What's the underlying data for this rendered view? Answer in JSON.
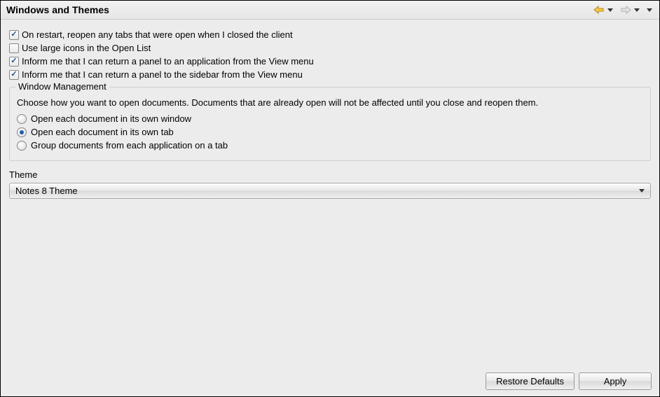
{
  "header": {
    "title": "Windows and Themes"
  },
  "checkboxes": [
    {
      "label": "On restart, reopen any tabs that were open when I closed the client",
      "checked": true
    },
    {
      "label": "Use large icons in the Open List",
      "checked": false
    },
    {
      "label": "Inform me that I can return a panel to an application from the View menu",
      "checked": true
    },
    {
      "label": "Inform me that I can return a panel to the sidebar from the View menu",
      "checked": true
    }
  ],
  "window_mgmt": {
    "legend": "Window Management",
    "description": "Choose how you want to open documents.  Documents that are already open will not be affected until you close and reopen them.",
    "options": [
      {
        "label": "Open each document in its own window",
        "selected": false
      },
      {
        "label": "Open each document in its own tab",
        "selected": true
      },
      {
        "label": "Group documents from each application on a tab",
        "selected": false
      }
    ]
  },
  "theme": {
    "label": "Theme",
    "selected": "Notes 8 Theme"
  },
  "footer": {
    "restore": "Restore Defaults",
    "apply": "Apply"
  }
}
